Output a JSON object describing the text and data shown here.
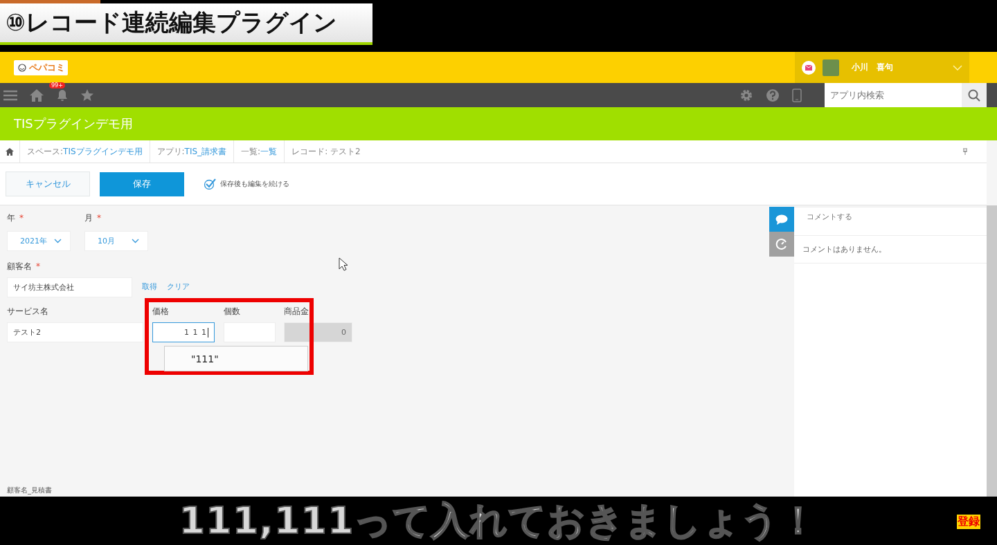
{
  "video_title": "⑩レコード連続編集プラグイン",
  "header": {
    "logo": "ペパコミ",
    "user_name": "小川　喜句"
  },
  "nav": {
    "notification_badge": "99+",
    "search": {
      "placeholder": "アプリ内検索"
    }
  },
  "space_title": "TISプラグインデモ用",
  "breadcrumb": [
    {
      "prefix": "スペース: ",
      "link": "TISプラグインデモ用"
    },
    {
      "prefix": "アプリ: ",
      "link": "TIS_請求書"
    },
    {
      "prefix": "一覧: ",
      "link": "一覧"
    },
    {
      "prefix": "レコード: テスト2"
    }
  ],
  "toolbar": {
    "cancel": "キャンセル",
    "save": "保存",
    "continue_editing": {
      "label": "保存後も編集を続ける",
      "checked": true
    }
  },
  "form": {
    "year": {
      "label": "年",
      "mark": "*",
      "value": "2021年"
    },
    "month": {
      "label": "月",
      "mark": "*",
      "value": "10月"
    },
    "customer": {
      "label": "顧客名",
      "mark": "*",
      "value": "サイ坊主株式会社",
      "actions": [
        "取得",
        "クリア"
      ]
    },
    "service": {
      "label": "サービス名",
      "value": "テスト2"
    },
    "price": {
      "label": "価格",
      "value": "1 1 1",
      "focused": true
    },
    "quantity": {
      "label": "個数"
    },
    "amount": {
      "label": "商品金",
      "value": "0"
    },
    "suggestion": "\"111\"",
    "bottom_label": "顧客名_見積書"
  },
  "comments": {
    "tabs": [
      {
        "kind": "comment",
        "selected": true
      },
      {
        "kind": "history",
        "selected": false
      }
    ],
    "placeholder": "コメントする",
    "empty": "コメントはありません。"
  },
  "caption": "111,111って入れておきましょう！",
  "subscribe_badge": "登録"
}
